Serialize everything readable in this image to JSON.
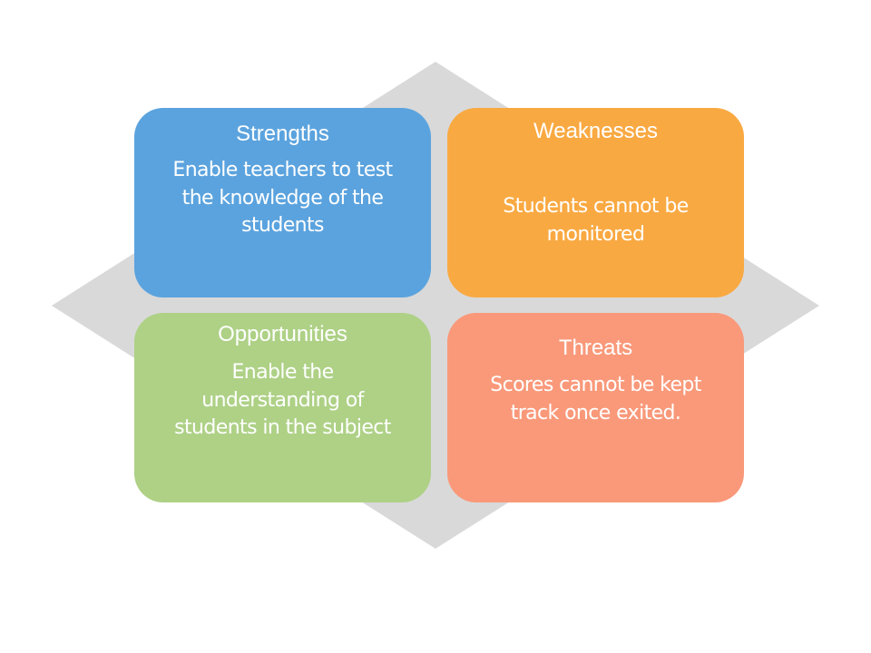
{
  "colors": {
    "background_diamond": "#D9D9D9",
    "strengths": "#5BA3DE",
    "weaknesses": "#F9A942",
    "opportunities": "#AED186",
    "threats": "#F9997A"
  },
  "quadrants": [
    {
      "key": "s",
      "title": "Strengths",
      "body": "Enable teachers to test\nthe knowledge of the\nstudents"
    },
    {
      "key": "w",
      "title": "Weaknesses",
      "body": "Students cannot be\nmonitored"
    },
    {
      "key": "o",
      "title": "Opportunities",
      "body": "Enable the\nunderstanding of\nstudents in the subject"
    },
    {
      "key": "t",
      "title": "Threats",
      "body": "Scores cannot be kept\ntrack once exited."
    }
  ]
}
